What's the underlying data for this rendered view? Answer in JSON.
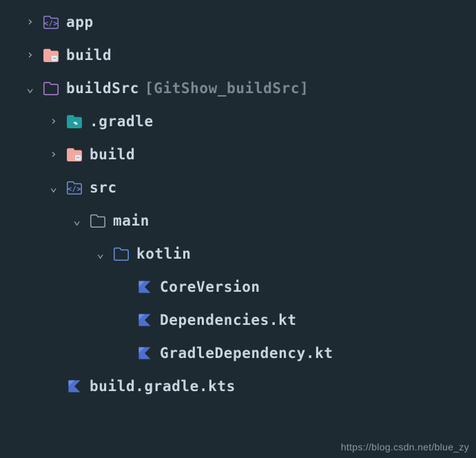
{
  "tree": [
    {
      "arrow": "right",
      "depth": 0,
      "icon": "code-folder-purple",
      "label": "app"
    },
    {
      "arrow": "right",
      "depth": 0,
      "icon": "build-folder",
      "label": "build"
    },
    {
      "arrow": "down",
      "depth": 0,
      "icon": "folder-purple",
      "label": "buildSrc",
      "suffix": "[GitShow_buildSrc]"
    },
    {
      "arrow": "right",
      "depth": 1,
      "icon": "gradle-folder",
      "label": ".gradle"
    },
    {
      "arrow": "right",
      "depth": 1,
      "icon": "build-folder",
      "label": "build"
    },
    {
      "arrow": "down",
      "depth": 1,
      "icon": "code-folder-blue",
      "label": "src"
    },
    {
      "arrow": "down",
      "depth": 2,
      "icon": "folder-outline",
      "label": "main"
    },
    {
      "arrow": "down",
      "depth": 3,
      "icon": "folder-blue",
      "label": "kotlin"
    },
    {
      "arrow": "none",
      "depth": 4,
      "icon": "kotlin-file",
      "label": "CoreVersion"
    },
    {
      "arrow": "none",
      "depth": 4,
      "icon": "kotlin-file",
      "label": "Dependencies.kt"
    },
    {
      "arrow": "none",
      "depth": 4,
      "icon": "kotlin-file",
      "label": "GradleDependency.kt"
    },
    {
      "arrow": "none",
      "depth": 1,
      "icon": "kotlin-file",
      "label": "build.gradle.kts"
    }
  ],
  "watermark": "https://blog.csdn.net/blue_zy"
}
